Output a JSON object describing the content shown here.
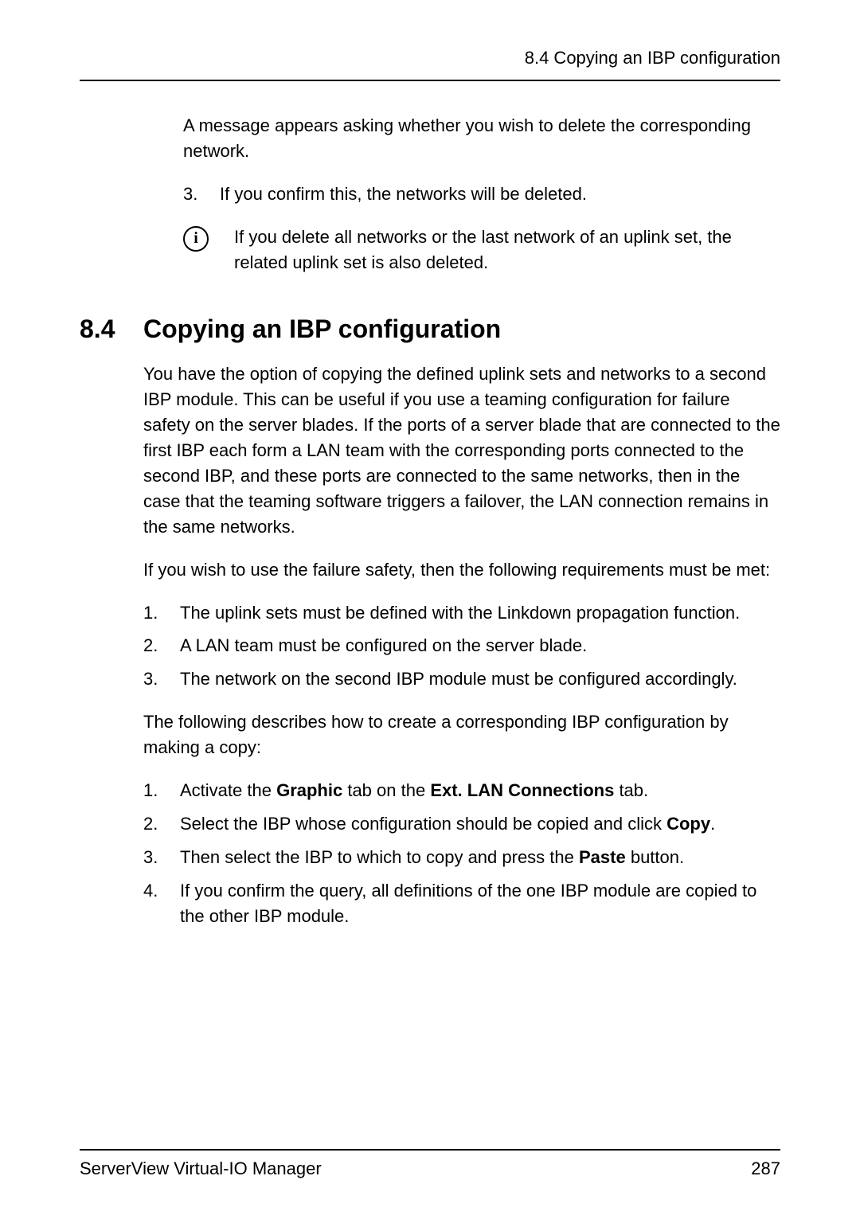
{
  "header": {
    "running_title": "8.4 Copying an IBP configuration"
  },
  "intro": {
    "message_para": "A message appears asking whether you wish to delete the corresponding network.",
    "list": [
      {
        "n": "3.",
        "text": "If you confirm this, the networks will be deleted."
      }
    ],
    "note": "If you delete all networks or the last network of an uplink set, the related uplink set is also deleted."
  },
  "section": {
    "number": "8.4",
    "title": "Copying an IBP configuration",
    "para1": "You have the option of copying the defined uplink sets and networks to a second IBP module. This can be useful if you use a teaming configuration for failure safety on the server blades. If the ports of a server blade that are connected to the first IBP each form a LAN team with the corresponding ports connected to the second IBP, and these ports are connected to the same networks, then in the case that the teaming software triggers a failover, the LAN connection remains in the same networks.",
    "para2": "If you wish to use the failure safety, then the following requirements must be met:",
    "requirements": [
      {
        "n": "1.",
        "text": "The uplink sets must be defined with the Linkdown propagation function."
      },
      {
        "n": "2.",
        "text": "A LAN team must be configured on the server blade."
      },
      {
        "n": "3.",
        "text": "The network on the second IBP module must be configured accordingly."
      }
    ],
    "para3": "The following describes how to create a corresponding IBP configuration by making a copy:",
    "steps": [
      {
        "n": "1.",
        "pre": "Activate the ",
        "b1": "Graphic",
        "mid": " tab on the ",
        "b2": "Ext. LAN Connections",
        "post": " tab."
      },
      {
        "n": "2.",
        "pre": "Select the IBP whose configuration should be copied and click ",
        "b1": "Copy",
        "mid": "",
        "b2": "",
        "post": "."
      },
      {
        "n": "3.",
        "pre": "Then select the IBP to which to copy and press the ",
        "b1": "Paste",
        "mid": "",
        "b2": "",
        "post": " button."
      },
      {
        "n": "4.",
        "pre": "If you confirm the query, all definitions of the one IBP module are copied to the other IBP module.",
        "b1": "",
        "mid": "",
        "b2": "",
        "post": ""
      }
    ]
  },
  "footer": {
    "product": "ServerView Virtual-IO Manager",
    "page": "287"
  },
  "info_glyph": "i"
}
